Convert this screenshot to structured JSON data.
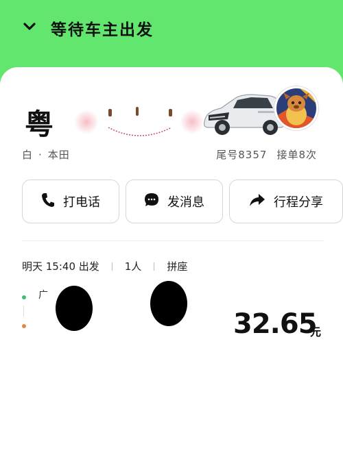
{
  "header": {
    "title": "等待车主出发"
  },
  "driver": {
    "plate_prefix": "粤",
    "car_color_label": "白",
    "car_sep": "·",
    "car_brand": "本田",
    "tail_number": "尾号8357",
    "order_count": "接单8次"
  },
  "actions": {
    "call_label": "打电话",
    "message_label": "发消息",
    "share_label": "行程分享"
  },
  "trip": {
    "time": "明天 15:40 出发",
    "passengers": "1人",
    "type": "拼座",
    "start_initial": "广",
    "price": "32.65",
    "price_unit": "元"
  },
  "colors": {
    "brand_green": "#63e66e",
    "start_dot": "#3cbf74",
    "end_dot": "#e08a4a"
  },
  "icons": {
    "collapse": "chevron-down-icon",
    "call": "phone-icon",
    "message": "chat-bubble-icon",
    "share": "share-arrow-icon"
  }
}
